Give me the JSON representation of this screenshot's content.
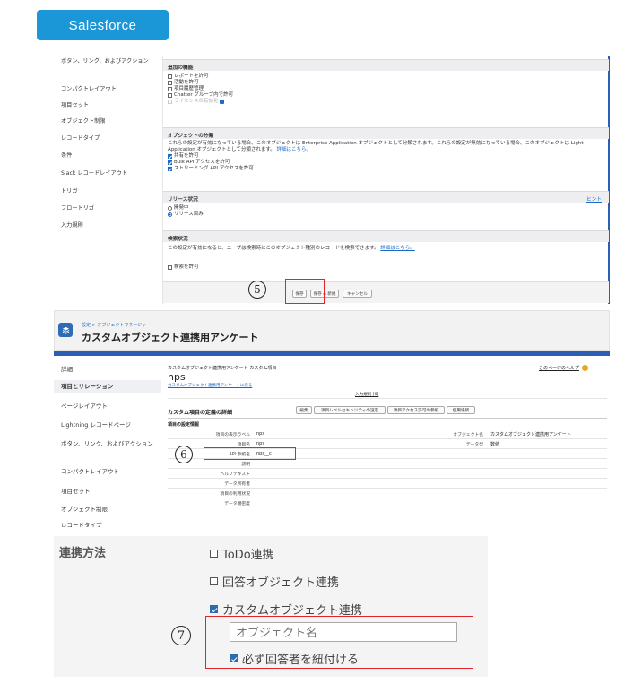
{
  "badge": "Salesforce",
  "panel1": {
    "sidebar": [
      "ボタン、リンク、およびアクション",
      "コンパクトレイアウト",
      "項目セット",
      "オブジェクト制限",
      "レコードタイプ",
      "条件",
      "Slack レコードレイアウト",
      "トリガ",
      "フロートリガ",
      "入力規則"
    ],
    "features_title": "追加の機能",
    "features": [
      "レポートを許可",
      "活動を許可",
      "項目履歴管理",
      "Chatter グループ内で許可",
      "ライセンスの有効化"
    ],
    "split_title": "オブジェクトの分類",
    "split_text": "これらの設定が有効になっている場合、このオブジェクトは Enterprise Application オブジェクトとして分類されます。これらの設定が無効になっている場合、このオブジェクトは Light Application オブジェクトとして分類されます。",
    "split_link": "詳細はこちら。",
    "split_options": [
      "共有を許可",
      "Bulk API アクセスを許可",
      "ストリーミング API アクセスを許可"
    ],
    "release_title": "リリース状況",
    "release_hint": "ヒント",
    "release_options": [
      "開発中",
      "リリース済み"
    ],
    "search_title": "検索状況",
    "search_text": "この設定が有効になると、ユーザは検索時にこのオブジェクト種別のレコードを検索できます。",
    "search_link": "詳細はこちら。",
    "search_option": "検索を許可",
    "buttons": {
      "save": "保存",
      "save_new": "保存 & 新規",
      "cancel": "キャンセル"
    },
    "step": "⑤"
  },
  "panel2": {
    "breadcrumb": "設定 > オブジェクトマネージャ",
    "title": "カスタムオブジェクト連携用アンケート",
    "sidebar": [
      "詳細",
      "項目とリレーション",
      "ページレイアウト",
      "Lightning レコードページ",
      "ボタン、リンク、およびアクション",
      "コンパクトレイアウト",
      "項目セット",
      "オブジェクト制限",
      "レコードタイプ"
    ],
    "top_label": "カスタムオブジェクト連携用アンケート カスタム項目",
    "field": "nps",
    "back_link": "カスタムオブジェクト連携用アンケートに戻る",
    "help_link": "このページのヘルプ",
    "validation_link": "入力規則 [0]",
    "section_title": "カスタム項目の定義の詳細",
    "section_buttons": [
      "編集",
      "項目レベルセキュリティの設定",
      "項目アクセス許可の参照",
      "使用場所"
    ],
    "info_title": "項目の設定情報",
    "rows": [
      {
        "label": "項目の表示ラベル",
        "value": "nps"
      },
      {
        "label": "項目名",
        "value": "nps"
      },
      {
        "label": "API 参照名",
        "value": "nps__c"
      },
      {
        "label": "説明",
        "value": ""
      },
      {
        "label": "ヘルプテキスト",
        "value": ""
      },
      {
        "label": "データ所有者",
        "value": ""
      },
      {
        "label": "項目の利用状況",
        "value": ""
      },
      {
        "label": "データ機密度",
        "value": ""
      }
    ],
    "right_rows": [
      {
        "label": "オブジェクト名",
        "value": "カスタムオブジェクト連携用アンケート"
      },
      {
        "label": "データ型",
        "value": "数値"
      }
    ],
    "step": "⑥"
  },
  "panel3": {
    "label": "連携方法",
    "options": [
      "ToDo連携",
      "回答オブジェクト連携",
      "カスタムオブジェクト連携"
    ],
    "input_placeholder": "オブジェクト名",
    "required_option": "必ず回答者を紐付ける",
    "step": "⑦"
  }
}
